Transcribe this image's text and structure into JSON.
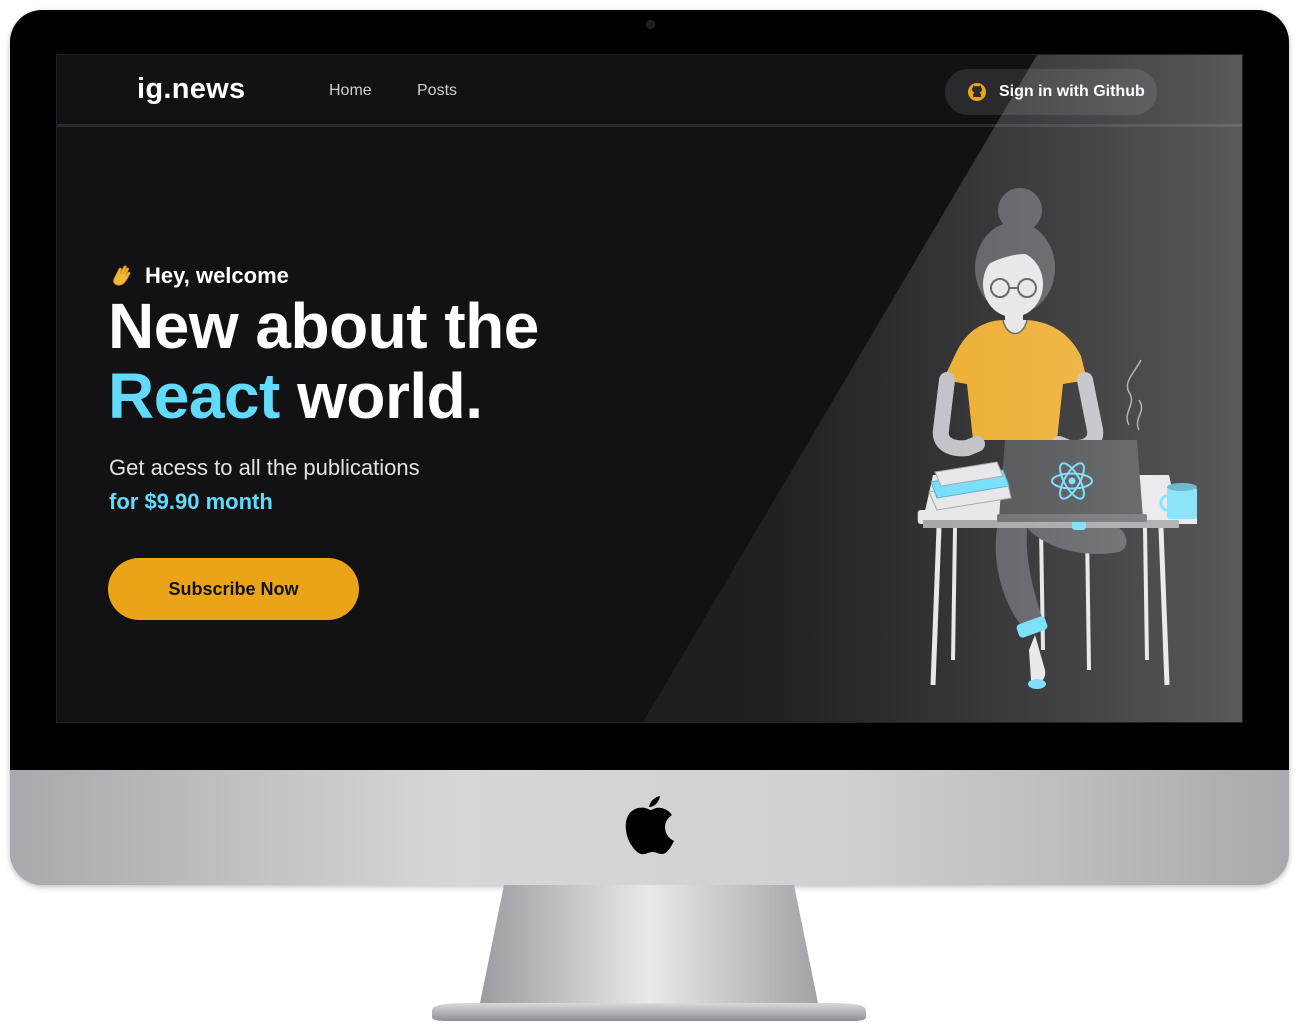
{
  "header": {
    "brand": "ig.news",
    "nav": [
      {
        "label": "Home"
      },
      {
        "label": "Posts"
      }
    ],
    "signin_label": "Sign in with Github",
    "signin_icon": "github-icon"
  },
  "hero": {
    "greeting": "Hey, welcome",
    "greeting_icon": "waving-hand-icon",
    "title_line1": "New about the",
    "title_accent": "React",
    "title_rest": " world.",
    "subtitle": "Get acess to all the publications",
    "price": "for $9.90 month",
    "cta_label": "Subscribe Now"
  },
  "colors": {
    "background": "#121214",
    "accent_cyan": "#61dafb",
    "accent_yellow": "#eba417",
    "header_border": "#29292e"
  }
}
